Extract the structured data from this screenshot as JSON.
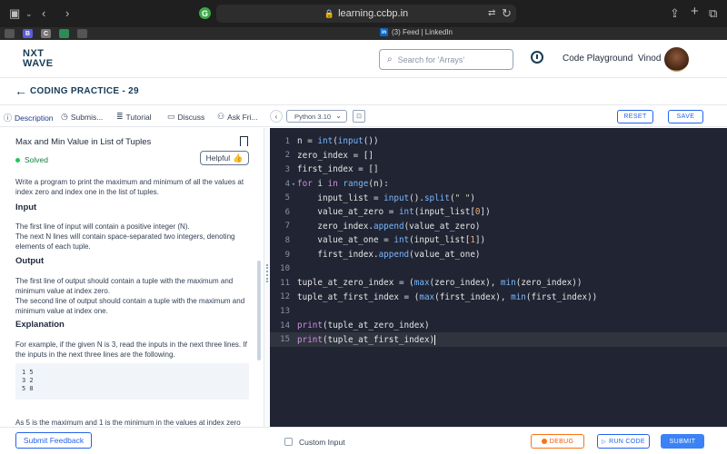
{
  "browser": {
    "url": "learning.ccbp.in",
    "tab_title": "(3) Feed | LinkedIn",
    "favicon_g": "G",
    "favicons": [
      "B",
      "C"
    ]
  },
  "header": {
    "logo_line1": "NXT",
    "logo_line2": "WAVE",
    "search_placeholder": "Search for 'Arrays'",
    "playground_label": "Code Playground",
    "user_name": "Vinod"
  },
  "practice": {
    "title": "CODING PRACTICE - 29"
  },
  "tabs": [
    {
      "label": "Description",
      "icon": "info-icon"
    },
    {
      "label": "Submis...",
      "icon": "history-icon"
    },
    {
      "label": "Tutorial",
      "icon": "document-icon"
    },
    {
      "label": "Discuss",
      "icon": "chat-icon"
    },
    {
      "label": "Ask Fri...",
      "icon": "people-icon"
    }
  ],
  "editor_toolbar": {
    "language": "Python 3.10",
    "reset_label": "RESET",
    "save_label": "SAVE"
  },
  "question": {
    "title": "Max and Min Value in List of Tuples",
    "status": "Solved",
    "helpful_label": "Helpful",
    "intro": "Write a program to print the maximum and minimum of all the values at index zero and index one in the list of tuples.",
    "input_heading": "Input",
    "input_line1": "The first line of input will contain a positive integer (N).",
    "input_line2": "The next N lines will contain space-separated two integers, denoting elements of each tuple.",
    "output_heading": "Output",
    "output_line1": "The first line of output should contain a tuple with the maximum and minimum value at index zero.",
    "output_line2": "The second line of output should contain a tuple with the maximum and minimum value at index one.",
    "explanation_heading": "Explanation",
    "explanation_text": "For example, if the given N is 3, read the inputs in the next three lines. If the inputs in the next three lines are the following.",
    "sample_input": "1 5\n3 2\n5 8",
    "cut_text": "As 5 is the maximum and 1 is the minimum in the values at index zero"
  },
  "code_lines": [
    "n = int(input())",
    "zero_index = []",
    "first_index = []",
    "for i in range(n):",
    "    input_list = input().split(\" \")",
    "    value_at_zero = int(input_list[0])",
    "    zero_index.append(value_at_zero)",
    "    value_at_one = int(input_list[1])",
    "    first_index.append(value_at_one)",
    "",
    "tuple_at_zero_index = (max(zero_index), min(zero_index))",
    "tuple_at_first_index = (max(first_index), min(first_index))",
    "",
    "print(tuple_at_zero_index)",
    "print(tuple_at_first_index)"
  ],
  "bottom": {
    "feedback_label": "Submit Feedback",
    "custom_input_label": "Custom Input",
    "debug_label": "DEBUG",
    "run_label": "RUN CODE",
    "submit_label": "SUBMIT"
  },
  "colors": {
    "brand": "#183b56",
    "accent": "#2563eb",
    "editor_bg": "#212432",
    "solved": "#15803d",
    "debug": "#f97316"
  }
}
